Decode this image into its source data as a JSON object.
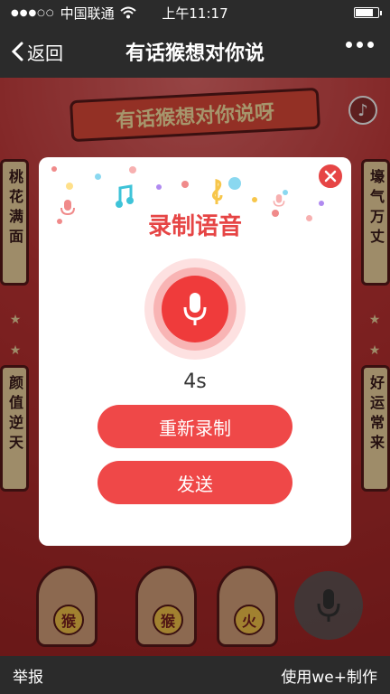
{
  "status_bar": {
    "signal_dots": "●●●○○",
    "carrier": "中国联通",
    "time": "上午11:17",
    "battery_level": 0.82
  },
  "nav": {
    "back_label": "返回",
    "title": "有话猴想对你说"
  },
  "stage": {
    "banner": "有话猴想对你说呀",
    "music_icon": "♪",
    "left_top_text": "桃花满面",
    "left_bottom_text": "颜值逆天",
    "right_top_text": "壕气万丈",
    "right_bottom_text": "好运常来",
    "star": "★",
    "monkey_medals": [
      "猴",
      "猴",
      "火"
    ]
  },
  "dialog": {
    "title": "录制语音",
    "duration": "4s",
    "rerecord_label": "重新录制",
    "send_label": "发送"
  },
  "bottom_bar": {
    "report_label": "举报",
    "credit_label": "使用we+制作"
  },
  "colors": {
    "accent": "#ef4848",
    "nav_bg": "#2b2b2b",
    "stage_bg": "#c33b3b"
  }
}
